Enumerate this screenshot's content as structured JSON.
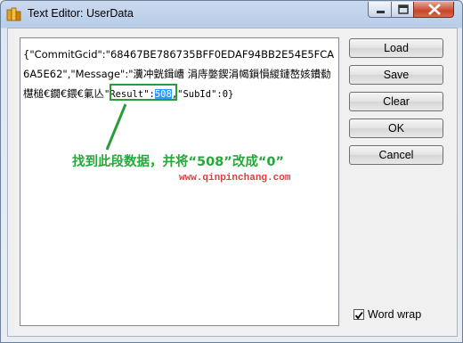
{
  "window": {
    "title": "Text Editor: UserData"
  },
  "editor": {
    "part1": "{\"CommitGcid\":\"68467BE786735BFF0EDAF94BB2E54E5FCA6A5E62\",\"Message\":\"瀵冲皝鍓嶆  涓庤嫳鍥涓幆鎻愪緵鏈嶅姟鐨勬櫘槌€鐗€鍡€氭亾",
    "part2": "\"Result\":",
    "selected": "508",
    "part3": ",\"SubId\":0}"
  },
  "annotation": {
    "text": "找到此段数据，并将“508”改成“0”",
    "watermark": "www.qinpinchang.com"
  },
  "buttons": {
    "load": "Load",
    "save": "Save",
    "clear": "Clear",
    "ok": "OK",
    "cancel": "Cancel"
  },
  "word_wrap": {
    "label": "Word wrap",
    "checked": true
  },
  "colors": {
    "annotation": "#27a83a",
    "selection": "#3399ff",
    "watermark": "#d84040"
  }
}
